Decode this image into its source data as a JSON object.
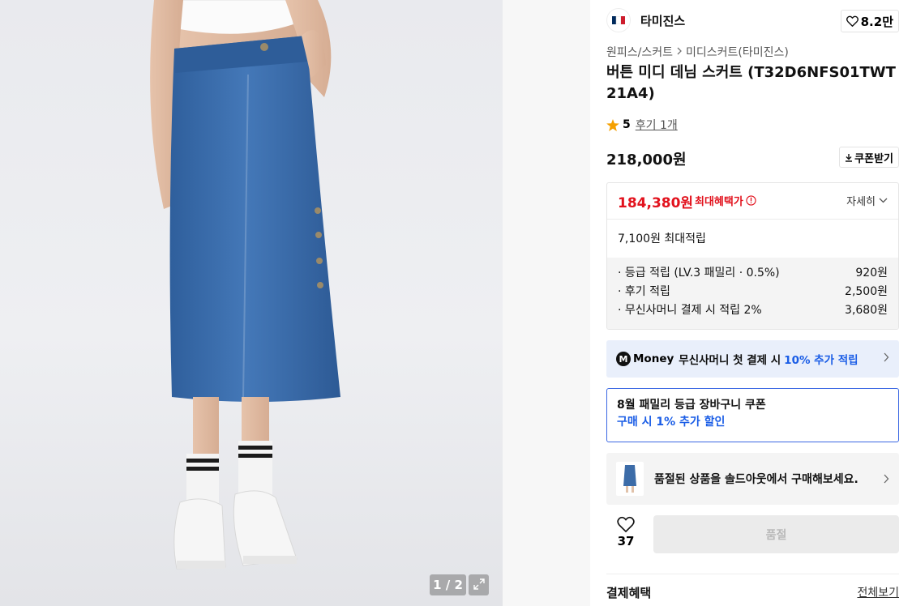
{
  "gallery": {
    "counter": "1 / 2",
    "icons": {
      "expand": "expand-icon"
    }
  },
  "brand": {
    "name": "타미진스",
    "like_count": "8.2만",
    "icons": {
      "logo": "tommy-flag-logo",
      "like": "heart-outline-icon"
    },
    "logo_colors": [
      "#002a5c",
      "#ffffff",
      "#cd1c2c"
    ]
  },
  "breadcrumb": {
    "category": "원피스/스커트",
    "subcategory": "미디스커트(타미진스)"
  },
  "product": {
    "title": "버튼 미디 데님 스커트 (T32D6NFS01TWT21A4)",
    "rating": "5",
    "review_link": "후기 1개",
    "price": "218,000원",
    "coupon_button": "쿠폰받기"
  },
  "benefit": {
    "sale_price": "184,380원",
    "sale_label": "최대혜택가",
    "detail_toggle": "자세히",
    "points_total": "7,100원 최대적립",
    "points": [
      {
        "label": "· 등급 적립 (LV.3 패밀리 · 0.5%)",
        "value": "920원"
      },
      {
        "label": "· 후기 적립",
        "value": "2,500원"
      },
      {
        "label": "· 무신사머니 결제 시 적립 2%",
        "value": "3,680원"
      }
    ]
  },
  "money_banner": {
    "badge": "M",
    "word": "Money",
    "text": "무신사머니 첫 결제 시",
    "accent": "10% 추가 적립"
  },
  "coupon_banner": {
    "line1": "8월 패밀리 등급 장바구니 쿠폰",
    "line2": "구매 시 1% 추가 할인"
  },
  "soldout_banner": {
    "text": "품절된 상품을 솔드아웃에서 구매해보세요."
  },
  "actions": {
    "like_count": "37",
    "buy_label": "품절"
  },
  "payment": {
    "title": "결제혜택",
    "view_all": "전체보기"
  },
  "colors": {
    "sale_red": "#e2121d",
    "accent_blue": "#1a5de6",
    "money_banner_bg": "#e9effb",
    "denim": "#3c6ca8"
  }
}
